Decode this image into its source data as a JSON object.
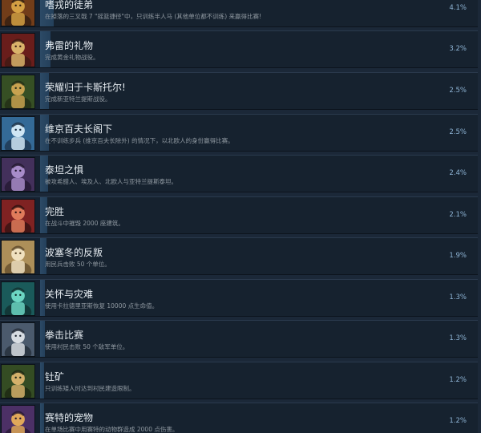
{
  "achievements": [
    {
      "name": "嗜戎的徒弟",
      "desc": "在掉落的三叉戟 7 \"摇篮捷径\"中，只训练半人马 (其他单位都不训练) 来赢得比赛!",
      "percent": "4.1%",
      "icon": "warrior-helmet-icon",
      "colors": [
        "#8b4a1c",
        "#d4a043",
        "#2b1a10"
      ]
    },
    {
      "name": "弗雷的礼物",
      "desc": "完成黄金礼物战役。",
      "percent": "3.2%",
      "icon": "blond-warrior-icon",
      "colors": [
        "#7a1f1f",
        "#d9b36a",
        "#3a1a12"
      ]
    },
    {
      "name": "荣耀归于卡斯托尔!",
      "desc": "完成新亚特兰提斯战役。",
      "percent": "2.5%",
      "icon": "armored-hero-icon",
      "colors": [
        "#3f5c2a",
        "#c8a250",
        "#1f2a14"
      ]
    },
    {
      "name": "维京百夫长阁下",
      "desc": "在不训练步兵 (维京百夫长除外) 的情况下，以北欧人的身份赢得比赛。",
      "percent": "2.5%",
      "icon": "ice-warrior-icon",
      "colors": [
        "#3d7fb3",
        "#cfe6f4",
        "#1b2f44"
      ]
    },
    {
      "name": "泰坦之惧",
      "desc": "被攻希腊人、埃及人、北欧人与亚特兰提斯泰坦。",
      "percent": "2.4%",
      "icon": "titan-icon",
      "colors": [
        "#4f3a6b",
        "#a88cc9",
        "#20162c"
      ]
    },
    {
      "name": "完胜",
      "desc": "在战斗中摧毁 2000 座建筑。",
      "percent": "2.1%",
      "icon": "ruined-city-icon",
      "colors": [
        "#9c2a2a",
        "#e07b5b",
        "#2a0f0f"
      ]
    },
    {
      "name": "波塞冬的反叛",
      "desc": "用民兵击败 50 个单位。",
      "percent": "1.9%",
      "icon": "militia-icon",
      "colors": [
        "#c9a86b",
        "#f0e1bf",
        "#5a4527"
      ]
    },
    {
      "name": "关怀与灾难",
      "desc": "使用卡拉德里亚斯恢复 10000 点生命值。",
      "percent": "1.3%",
      "icon": "healer-icon",
      "colors": [
        "#1f6b6b",
        "#6cd6c3",
        "#0f2a2a"
      ]
    },
    {
      "name": "拳击比赛",
      "desc": "使用村民击败 50 个敌军单位。",
      "percent": "1.3%",
      "icon": "rhino-icon",
      "colors": [
        "#5a6b82",
        "#d8dde3",
        "#202833"
      ]
    },
    {
      "name": "钍矿",
      "desc": "只训练矮人时达到村民建造限制。",
      "percent": "1.2%",
      "icon": "dwarf-miner-icon",
      "colors": [
        "#3d5a2a",
        "#d4b06a",
        "#1a2410"
      ]
    },
    {
      "name": "赛特的宠物",
      "desc": "在单场比赛中用赛特的动物群造成 2000 点伤害。",
      "percent": "1.2%",
      "icon": "beast-icon",
      "colors": [
        "#5a3a7a",
        "#e0a85a",
        "#24162f"
      ]
    }
  ],
  "progress": [
    0.72,
    0.56,
    0.44,
    0.44,
    0.42,
    0.37,
    0.33,
    0.23,
    0.23,
    0.21,
    0.21
  ]
}
